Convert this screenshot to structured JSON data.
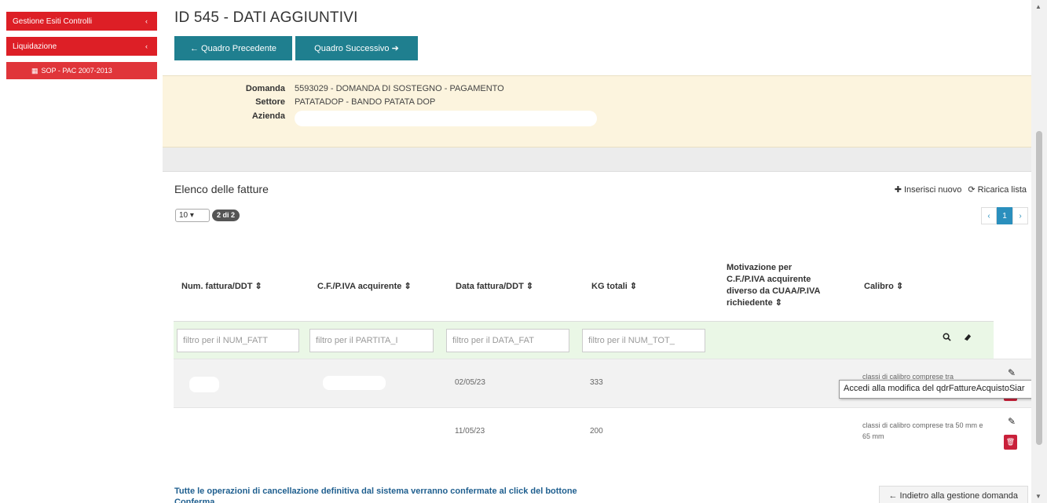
{
  "sidebar": {
    "items": [
      {
        "label": "Gestione Esiti Controlli",
        "chevron": "‹"
      },
      {
        "label": "Liquidazione",
        "chevron": "‹"
      }
    ],
    "sub_item": {
      "label": "SOP - PAC 2007-2013",
      "icon": "calendar-icon"
    }
  },
  "header": {
    "title": "ID 545 - DATI AGGIUNTIVI",
    "prev_label": "← Quadro Precedente",
    "next_label": "Quadro Successivo ➔"
  },
  "info": {
    "domanda_label": "Domanda",
    "domanda_value": "5593029 - DOMANDA DI SOSTEGNO - PAGAMENTO",
    "settore_label": "Settore",
    "settore_value": "PATATADOP - BANDO PATATA DOP",
    "azienda_label": "Azienda"
  },
  "panel": {
    "title": "Elenco delle fatture",
    "insert_label": "✚ Inserisci nuovo",
    "reload_label": "⟳ Ricarica lista",
    "page_size": "10 ▾",
    "count_badge": "2 di 2",
    "pager": {
      "prev": "‹",
      "current": "1",
      "next": "›"
    }
  },
  "table": {
    "headers": {
      "num_fattura": "Num. fattura/DDT ⇕",
      "cf_piva": "C.F./P.IVA acquirente ⇕",
      "data_fattura": "Data fattura/DDT ⇕",
      "kg_totali": "KG totali ⇕",
      "motivazione": [
        "Motivazione per",
        "C.F./P.IVA acquirente",
        "diverso da CUAA/P.IVA",
        "richiedente ⇕"
      ],
      "calibro": "Calibro ⇕"
    },
    "filters": {
      "num_fatt": "filtro per il NUM_FATT",
      "partita": "filtro per il PARTITA_I",
      "data_fat": "filtro per il DATA_FAT",
      "num_tot": "filtro per il NUM_TOT_"
    },
    "filter_search_icon": "search-icon",
    "filter_clear_icon": "eraser-icon",
    "rows": [
      {
        "data": "02/05/23",
        "kg": "333",
        "calibro": "classi di calibro comprese tra"
      },
      {
        "data": "11/05/23",
        "kg": "200",
        "calibro": "classi di calibro comprese tra 50 mm e 65 mm"
      }
    ]
  },
  "tooltip": "Accedi alla modifica del qdrFattureAcquistoSiar",
  "footer": {
    "note": "Tutte le operazioni di cancellazione definitiva dal sistema verranno confermate al click del bottone Conferma",
    "back_label": "← Indietro alla gestione domanda"
  }
}
